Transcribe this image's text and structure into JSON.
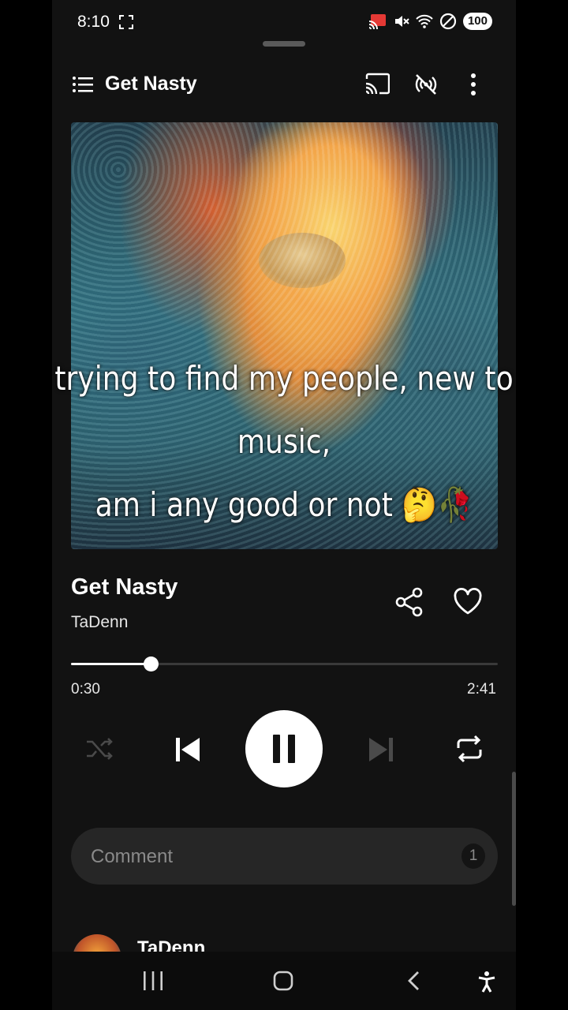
{
  "status_bar": {
    "time": "8:10",
    "battery": "100",
    "icons": [
      "screen-record-icon",
      "cast-active-icon",
      "mute-icon",
      "wifi-icon",
      "dnd-icon"
    ]
  },
  "header": {
    "title": "Get Nasty",
    "icons": [
      "menu-icon",
      "cast-icon",
      "radio-icon",
      "more-vertical-icon"
    ]
  },
  "caption": {
    "lines": [
      "trying to find my people, new to",
      "music,",
      "am i any good or not 🤔🥀"
    ]
  },
  "track": {
    "title": "Get Nasty",
    "artist": "TaDenn"
  },
  "playback": {
    "elapsed": "0:30",
    "duration": "2:41",
    "progress_fraction": 0.186,
    "state": "playing"
  },
  "controls": [
    "shuffle-icon",
    "previous-icon",
    "pause-icon",
    "next-icon",
    "repeat-icon"
  ],
  "comments": {
    "placeholder": "Comment",
    "count": "1",
    "first_author": "TaDenn"
  },
  "colors": {
    "background": "#121212",
    "accent": "#ffffff",
    "muted": "#8a8a8a",
    "comment_bg": "#262626"
  }
}
